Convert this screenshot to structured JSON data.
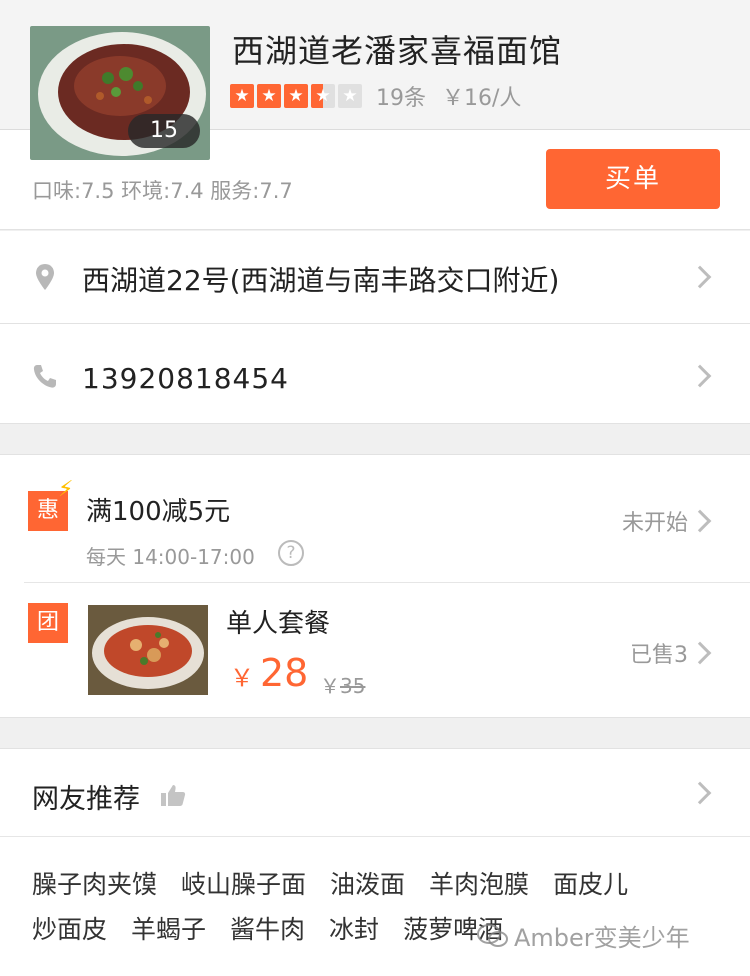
{
  "shop": {
    "name": "西湖道老潘家喜福面馆",
    "photo_count": "15",
    "rating": 3.5,
    "review_count": "19条",
    "avg_price": "￥16/人",
    "scores": "口味:7.5  环境:7.4  服务:7.7",
    "pay_label": "买单"
  },
  "info": {
    "address": "西湖道22号(西湖道与南丰路交口附近)",
    "phone": "13920818454"
  },
  "promo": {
    "badge": "惠",
    "title": "满100减5元",
    "time": "每天 14:00-17:00",
    "help": "?",
    "status": "未开始"
  },
  "group_deal": {
    "badge": "团",
    "name": "单人套餐",
    "currency": "￥",
    "price": "28",
    "orig_currency": "￥",
    "orig_price": "35",
    "sold": "已售3"
  },
  "recommend": {
    "title": "网友推荐",
    "dishes_row1": [
      "臊子肉夹馍",
      "岐山臊子面",
      "油泼面",
      "羊肉泡膜",
      "面皮儿"
    ],
    "dishes_row2": [
      "炒面皮",
      "羊蝎子",
      "酱牛肉",
      "冰封",
      "菠萝啤酒"
    ]
  },
  "watermark": "Amber变美少年",
  "colors": {
    "accent": "#ff6633",
    "muted": "#999999",
    "divider": "#e2e2e2"
  },
  "icons": [
    "location-pin-icon",
    "phone-icon",
    "chevron-right-icon",
    "lightning-icon",
    "help-icon",
    "thumbs-up-icon",
    "wechat-icon"
  ]
}
